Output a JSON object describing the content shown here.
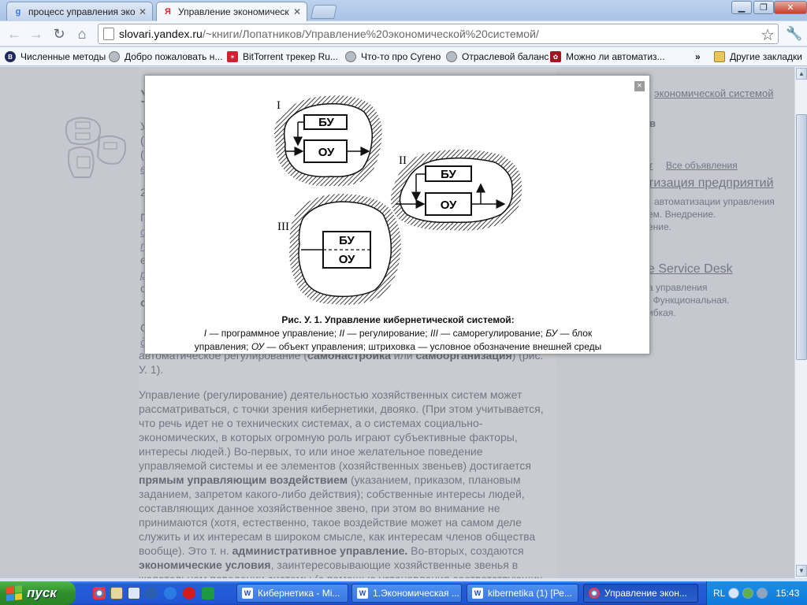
{
  "browser": {
    "tabs": [
      {
        "title": "процесс управления эконом",
        "icon": "google-icon"
      },
      {
        "title": "Управление экономической",
        "icon": "yandex-icon",
        "active": true
      }
    ],
    "address": {
      "host": "slovari.yandex.ru",
      "path": "/~книги/Лопатников/Управление%20экономической%20системой/"
    },
    "bookmarks": [
      {
        "label": "Численные методы",
        "icon": "bookmark-icon-dark"
      },
      {
        "label": "Добро пожаловать н...",
        "icon": "globe-icon"
      },
      {
        "label": "BitTorrent трекер Ru...",
        "icon": "bittorrent-icon"
      },
      {
        "label": "Что-то про Сугено",
        "icon": "globe-icon"
      },
      {
        "label": "Отраслевой баланс",
        "icon": "globe-icon"
      },
      {
        "label": "Можно ли автоматиз...",
        "icon": "red-site-icon"
      }
    ],
    "bookmarks_overflow": "»",
    "other_bookmarks": "Другие закладки"
  },
  "page": {
    "heading_fragment": "У",
    "left_letters": [
      "У",
      "(",
      "(",
      "е",
      "2",
      "П",
      "о",
      "п",
      "е",
      "р",
      "о",
      "о",
      "О",
      "д"
    ],
    "para_prev_tail": "автоматическое регулирование (",
    "para_prev_b1": "самонастройка",
    "para_prev_mid": " или ",
    "para_prev_b2": "самоорганизация",
    "para_prev_end": ") (рис.",
    "para_prev_line2": "У. 1).",
    "paragraph": [
      "Управление (регулирование) деятельностью хозяйственных систем может",
      "рассматриваться, с точки зрения кибернетики, двояко. (При этом учитывается,",
      "что речь идет не о технических системах, а о системах социально-",
      "экономических, в которых огромную роль играют субъективные факторы,",
      "интересы людей.) Во-первых, то или иное желательное поведение",
      "управляемой системы и ее элементов (хозяйственных звеньев) достигается"
    ],
    "p_bold1": "прямым управляющим воздействием",
    "p_after_bold1": " (указанием, приказом, плановым",
    "paragraph2": [
      "заданием, запретом какого-либо действия); собственные интересы людей,",
      "составляющих данное хозяйственное звено, при этом во внимание не",
      "принимаются (хотя, естественно, такое воздействие может на самом деле",
      "служить и их интересам в широком смысле, как интересам членов общества"
    ],
    "p_vob": "вообще). Это т. н. ",
    "p_bold2": "административное управление.",
    "p_after_bold2": " Во-вторых, создаются",
    "p_bold3": "экономические условия",
    "p_after_bold3": ", заинтересовывающие хозяйственные звенья в",
    "p_last": "желательном поведении системы (с помощью установления соответствующих",
    "side": {
      "link_top": "экономической системой",
      "heading": "в",
      "ads_left": "т",
      "ads_all": "Все объявления",
      "ad1_title": "тизация предприятий",
      "ad1_lines": [
        "автоматизации управления",
        "ем. Внедрение.",
        "ение."
      ],
      "ad2_title": "e Service Desk",
      "ad2_lines": [
        "а управления",
        ". Функциональная.",
        "ибкая."
      ]
    }
  },
  "popup": {
    "close": "×",
    "figure_labels": {
      "i": "I",
      "ii": "II",
      "iii": "III",
      "bu": "БУ",
      "ou": "ОУ"
    },
    "caption_title": "Рис. У. 1. Управление кибернетической системой:",
    "caption_l1_i": "I",
    "caption_l1_a": " — программное управление; ",
    "caption_l1_ii": "II",
    "caption_l1_b": " — регулирование; ",
    "caption_l1_iii": "III",
    "caption_l1_c": " — саморегулирование; ",
    "caption_l1_bu": "БУ",
    "caption_l1_d": " — блок",
    "caption_l2_a": "управления; ",
    "caption_l2_ou": "ОУ",
    "caption_l2_b": " — объект управления; штриховка — условное обозначение внешней среды"
  },
  "taskbar": {
    "start": "пуск",
    "tasks": [
      {
        "label": "Кибернетика - Mi...",
        "icon": "word-icon"
      },
      {
        "label": "1.Экономическая ...",
        "icon": "word-icon"
      },
      {
        "label": "kibernetika (1) [Ре...",
        "icon": "word-icon"
      },
      {
        "label": "Управление экон...",
        "icon": "chrome-icon",
        "active": true
      }
    ],
    "lang": "RL",
    "clock": "15:43"
  }
}
